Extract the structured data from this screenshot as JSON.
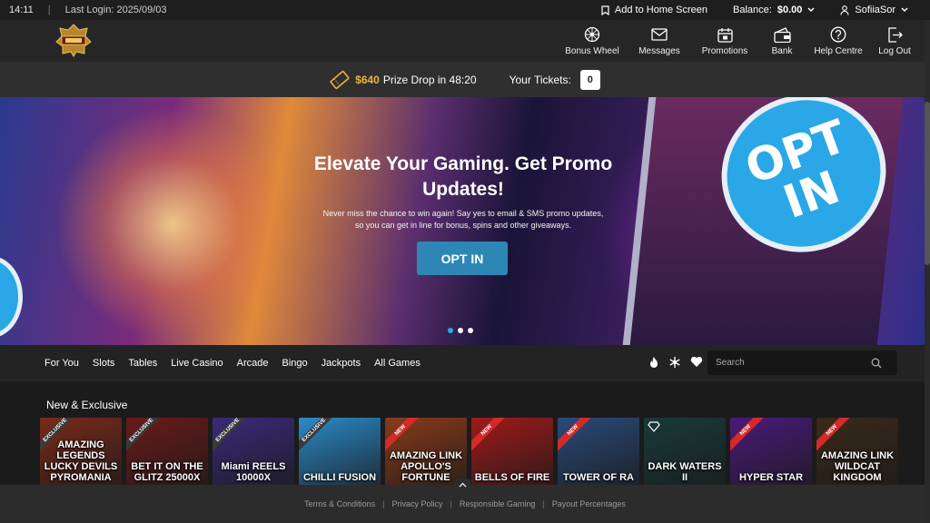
{
  "topbar": {
    "time": "14:11",
    "last_login": "Last Login: 2025/09/03",
    "add_home": "Add to Home Screen",
    "balance_label": "Balance:",
    "balance_value": "$0.00",
    "username": "SofiiaSor"
  },
  "nav": {
    "items": [
      {
        "label": "Bonus Wheel",
        "icon": "wheel-icon"
      },
      {
        "label": "Messages",
        "icon": "envelope-icon"
      },
      {
        "label": "Promotions",
        "icon": "calendar-gift-icon"
      },
      {
        "label": "Bank",
        "icon": "wallet-icon"
      },
      {
        "label": "Help Centre",
        "icon": "question-icon"
      },
      {
        "label": "Log Out",
        "icon": "logout-icon"
      }
    ]
  },
  "prize": {
    "amount": "$640",
    "text": "Prize Drop in 48:20",
    "tickets_label": "Your Tickets:",
    "tickets_value": "0"
  },
  "banner": {
    "heading": "Elevate Your Gaming. Get Promo Updates!",
    "subtext": "Never miss the chance to win again! Say yes to email & SMS promo updates, so you can get in line for bonus, spins and other giveaways.",
    "button": "OPT IN",
    "bubble_text": "OPT IN",
    "slides": 3,
    "active_slide": 1
  },
  "games_nav": {
    "categories": [
      "For You",
      "Slots",
      "Tables",
      "Live Casino",
      "Arcade",
      "Bingo",
      "Jackpots",
      "All Games"
    ],
    "search_placeholder": "Search"
  },
  "section": {
    "title": "New & Exclusive",
    "games": [
      {
        "name": "AMAZING LEGENDS LUCKY DEVILS PYROMANIA",
        "badge": "EXCLUSIVE",
        "color": "#7a2a1a",
        "badge_color": "#3a3a3a"
      },
      {
        "name": "BET IT ON THE GLITZ 25000X",
        "badge": "EXCLUSIVE",
        "color": "#6a1a1a",
        "badge_color": "#3a3a3a"
      },
      {
        "name": "Miami REELS 10000X",
        "badge": "EXCLUSIVE",
        "color": "#3a2a7a",
        "badge_color": "#3a3a3a"
      },
      {
        "name": "CHILLI FUSION",
        "badge": "EXCLUSIVE",
        "color": "#2a8ac8",
        "badge_color": "#3a3a3a"
      },
      {
        "name": "AMAZING LINK APOLLO'S FORTUNE",
        "badge": "NEW",
        "color": "#8a3a1a",
        "badge_color": "#d42a2a"
      },
      {
        "name": "BELLS OF FIRE",
        "badge": "NEW",
        "color": "#a01a1a",
        "badge_color": "#d42a2a"
      },
      {
        "name": "TOWER OF RA",
        "badge": "NEW",
        "color": "#2a4a7a",
        "badge_color": "#d42a2a"
      },
      {
        "name": "DARK WATERS II",
        "badge": "",
        "color": "#1a3a3a",
        "badge_color": ""
      },
      {
        "name": "HYPER STAR",
        "badge": "NEW",
        "color": "#4a1a7a",
        "badge_color": "#d42a2a"
      },
      {
        "name": "AMAZING LINK WILDCAT KINGDOM",
        "badge": "NEW",
        "color": "#3a2a1a",
        "badge_color": "#d42a2a"
      }
    ]
  },
  "footer": {
    "links": [
      "Terms & Conditions",
      "Privacy Policy",
      "Responsible Gaming",
      "Payout Percentages"
    ]
  }
}
